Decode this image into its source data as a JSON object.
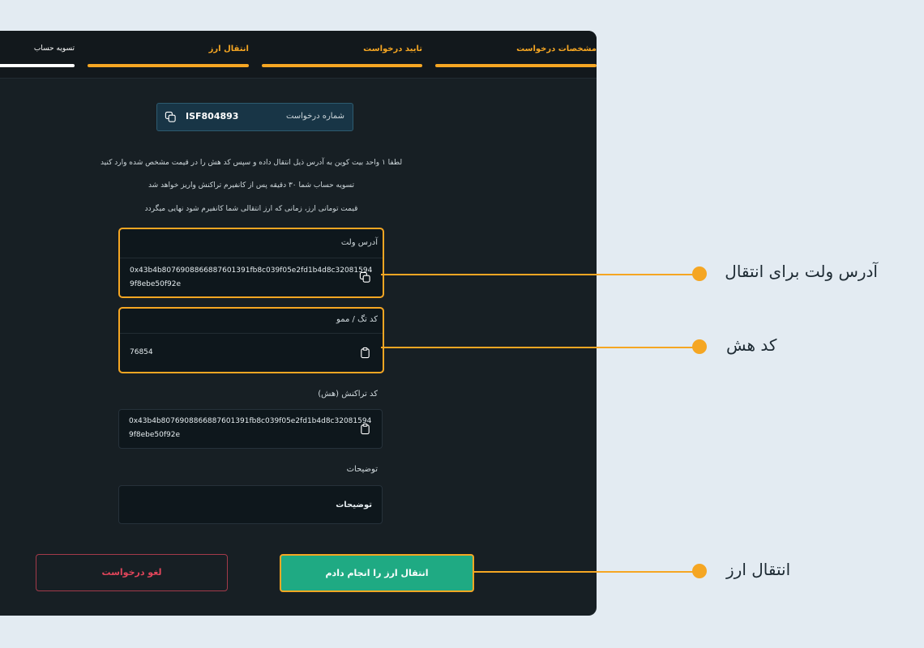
{
  "steps": [
    {
      "label": "مشخصات درخواست",
      "state": "done"
    },
    {
      "label": "تایید درخواست",
      "state": "done"
    },
    {
      "label": "انتقال ارز",
      "state": "done"
    },
    {
      "label": "تسویه حساب",
      "state": "current"
    }
  ],
  "request": {
    "label": "شماره درخواست",
    "number": "ISF804893",
    "icon": "copy-icon"
  },
  "info_lines": [
    "لطفا ۱ واحد بیت کوین به آدرس ذیل انتقال داده و سپس کد هش را در قیمت مشخص شده وارد کنید",
    "تسویه حساب شما ۳۰ دقیقه پس از کانفیرم تراکنش واریز خواهد شد",
    "قیمت تومانی ارز، زمانی که ارز انتقالی شما کانفیرم شود نهایی میگردد"
  ],
  "wallet": {
    "label": "آدرس ولت",
    "line1": "0x43b4b8076908866887601391fb8c039f05e2fd1b4d8c32081594",
    "line2": "9f8ebe50f92e",
    "icon": "copy-icon"
  },
  "tag": {
    "label": "کد تگ / ممو",
    "value": "76854",
    "icon": "clipboard-icon"
  },
  "tx": {
    "label": "کد تراکنش (هش)",
    "line1": "0x43b4b8076908866887601391fb8c039f05e2fd1b4d8c32081594",
    "line2": "9f8ebe50f92e",
    "icon": "clipboard-icon"
  },
  "notes": {
    "label": "توضیحات",
    "placeholder": "توضیحات"
  },
  "buttons": {
    "confirm": "انتقال ارز را انجام دادم",
    "cancel": "لغو درخواست"
  },
  "callouts": {
    "wallet": "آدرس ولت برای انتقال",
    "hash": "کد هش",
    "transfer": "انتقال ارز"
  },
  "colors": {
    "accent": "#f5a623",
    "panel": "#171f24",
    "success": "#1faa83",
    "danger": "#e0455a",
    "background": "#e3ebf2"
  }
}
